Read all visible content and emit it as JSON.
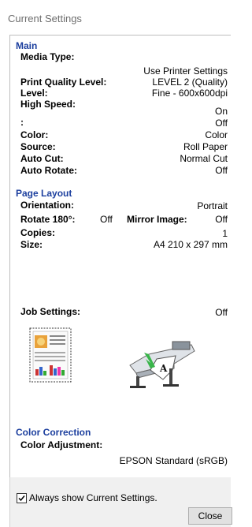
{
  "window": {
    "title": "Current Settings"
  },
  "main": {
    "heading": "Main",
    "media_type_label": "Media Type:",
    "media_type_value": "Use Printer Settings",
    "print_quality_label": "Print Quality Level:",
    "print_quality_value": "LEVEL 2 (Quality)",
    "level_label": "Level:",
    "level_value": "Fine - 600x600dpi",
    "high_speed_label": "High Speed:",
    "high_speed_value": "On",
    "blank_label": ":",
    "blank_value": "Off",
    "color_label": "Color:",
    "color_value": "Color",
    "source_label": "Source:",
    "source_value": "Roll Paper",
    "auto_cut_label": "Auto Cut:",
    "auto_cut_value": "Normal Cut",
    "auto_rotate_label": "Auto Rotate:",
    "auto_rotate_value": "Off"
  },
  "page_layout": {
    "heading": "Page Layout",
    "orientation_label": "Orientation:",
    "orientation_value": "Portrait",
    "rotate_label": "Rotate 180°:",
    "rotate_value": "Off",
    "mirror_label": "Mirror Image:",
    "mirror_value": "Off",
    "copies_label": "Copies:",
    "copies_value": "1",
    "size_label": "Size:",
    "size_value": "A4 210 x 297 mm"
  },
  "job": {
    "label": "Job Settings:",
    "value": "Off"
  },
  "color_correction": {
    "heading": "Color Correction",
    "adjustment_label": "Color Adjustment:",
    "adjustment_value": "EPSON Standard (sRGB)"
  },
  "footer": {
    "always_show_label": "Always show Current Settings.",
    "always_show_checked": true,
    "close_label": "Close"
  }
}
